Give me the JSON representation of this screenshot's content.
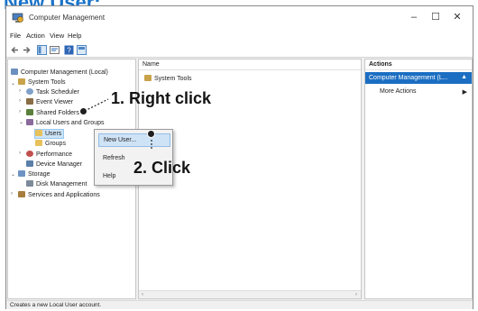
{
  "heading": "New User:",
  "window": {
    "title": "Computer Management",
    "controls": {
      "minimize": "–",
      "maximize": "☐",
      "close": "✕"
    }
  },
  "menu": [
    "File",
    "Action",
    "View",
    "Help"
  ],
  "tree": {
    "root": "Computer Management (Local)",
    "system_tools": "System Tools",
    "task_scheduler": "Task Scheduler",
    "event_viewer": "Event Viewer",
    "shared_folders": "Shared Folders",
    "local_users": "Local Users and Groups",
    "users": "Users",
    "groups": "Groups",
    "performance": "Performance",
    "device_manager": "Device Manager",
    "storage": "Storage",
    "disk_management": "Disk Management",
    "services": "Services and Applications"
  },
  "list": {
    "column_name": "Name",
    "rows": [
      "System Tools"
    ]
  },
  "actions": {
    "header": "Actions",
    "selected": "Computer Management (L...",
    "more": "More Actions"
  },
  "context_menu": [
    "New User...",
    "Refresh",
    "Help"
  ],
  "annotations": {
    "step1": "1. Right click",
    "step2": "2. Click"
  },
  "status": "Creates a new Local User account.",
  "colors": {
    "heading": "#1a73c9",
    "selection": "#1b6ec2",
    "menu_highlight": "#cfe3f7"
  }
}
